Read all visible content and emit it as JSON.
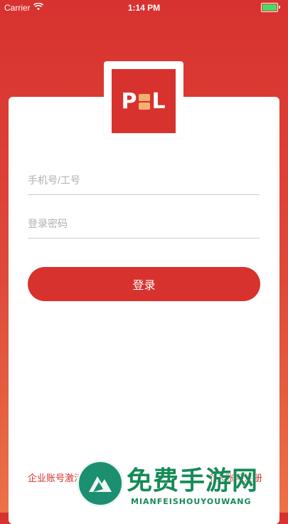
{
  "status_bar": {
    "carrier": "Carrier",
    "time": "1:14 PM",
    "wifi_icon": "wifi-icon",
    "battery_icon": "battery-icon"
  },
  "logo": {
    "text_left": "P",
    "text_right": "L",
    "accent": "#d7322e"
  },
  "form": {
    "phone_placeholder": "手机号/工号",
    "password_placeholder": "登录密码",
    "login_label": "登录"
  },
  "links": {
    "left": "企业账号激活",
    "right": "个人账号注册"
  },
  "watermark": {
    "title": "免费手游网",
    "subtitle": "MIANFEISHOUYOUWANG"
  },
  "colors": {
    "brand_red": "#d7322e",
    "background_top": "#d8322f",
    "background_bottom": "#ec7148"
  }
}
